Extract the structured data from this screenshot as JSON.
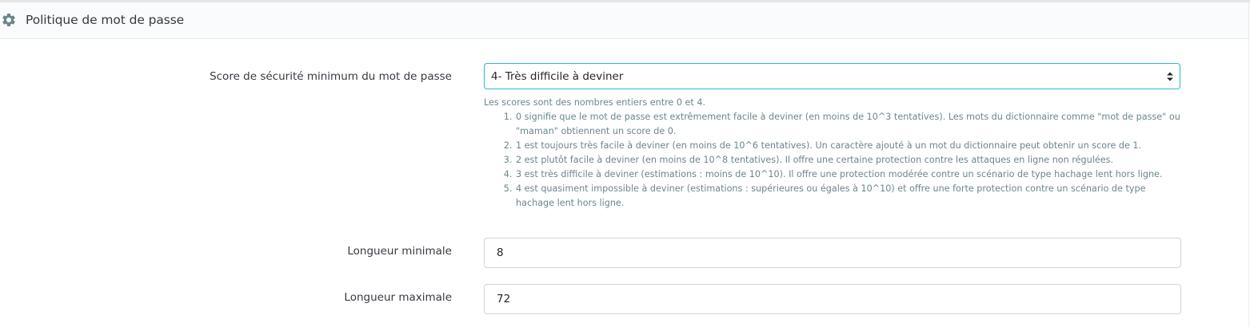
{
  "panel": {
    "title": "Politique de mot de passe",
    "icon": "gear-icon"
  },
  "fields": {
    "score": {
      "label": "Score de sécurité minimum du mot de passe",
      "selected": "4- Très difficile à deviner"
    },
    "min_length": {
      "label": "Longueur minimale",
      "value": "8"
    },
    "max_length": {
      "label": "Longueur maximale",
      "value": "72"
    }
  },
  "help": {
    "intro": "Les scores sont des nombres entiers entre 0 et 4.",
    "items": [
      "0 signifie que le mot de passe est extrêmement facile à deviner (en moins de 10^3 tentatives). Les mots du dictionnaire comme \"mot de passe\" ou \"maman\" obtiennent un score de 0.",
      "1 est toujours très facile à deviner (en moins de 10^6 tentatives). Un caractère ajouté à un mot du dictionnaire peut obtenir un score de 1.",
      "2 est plutôt facile à deviner (en moins de 10^8 tentatives). Il offre une certaine protection contre les attaques en ligne non régulées.",
      "3 est très difficile à deviner (estimations : moins de 10^10). Il offre une protection modérée contre un scénario de type hachage lent hors ligne.",
      "4 est quasiment impossible à deviner (estimations : supérieures ou égales à 10^10) et offre une forte protection contre un scénario de type hachage lent hors ligne."
    ]
  },
  "colors": {
    "accent": "#25b9d7",
    "text": "#363a41",
    "help_text": "#6c868e",
    "border": "#cfd5db"
  }
}
